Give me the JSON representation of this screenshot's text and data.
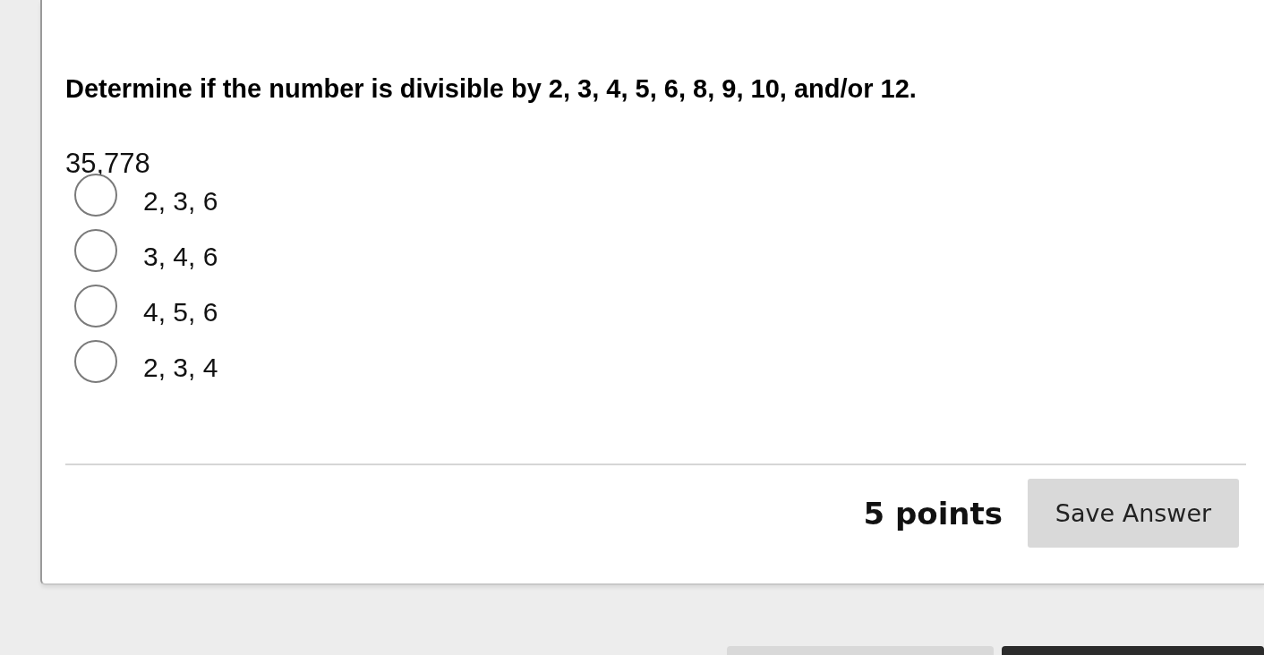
{
  "question": {
    "prompt": "Determine if the number is divisible by 2, 3, 4, 5, 6, 8, 9, 10, and/or 12.",
    "number": "35,778",
    "options": [
      {
        "label": "2, 3, 6",
        "selected": false
      },
      {
        "label": "3, 4, 6",
        "selected": false
      },
      {
        "label": "4, 5, 6",
        "selected": false
      },
      {
        "label": "2, 3, 4",
        "selected": false
      }
    ],
    "points": "5 points",
    "save_button": "Save Answer"
  }
}
